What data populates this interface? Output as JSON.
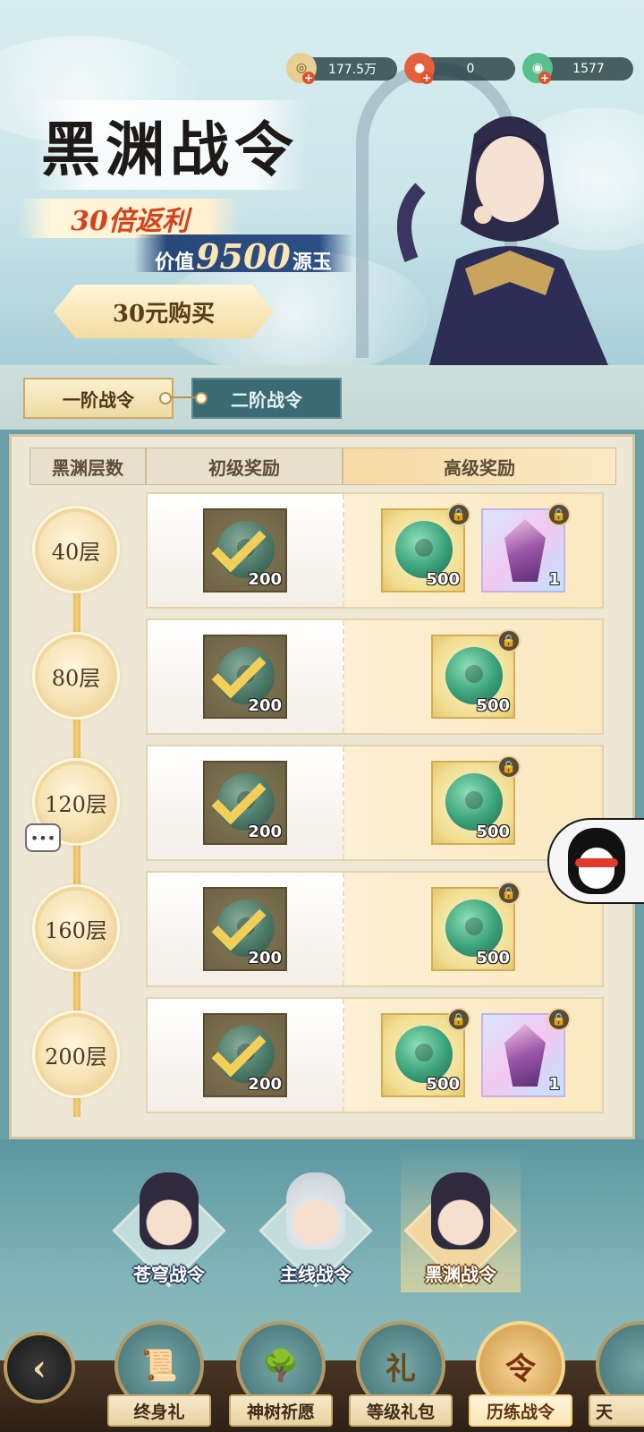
{
  "currencies": [
    {
      "icon": "coin-icon",
      "value": "177.5万",
      "color": "#d9b26a"
    },
    {
      "icon": "red-orb-icon",
      "value": "0",
      "color": "#e04f34"
    },
    {
      "icon": "jade-icon",
      "value": "1577",
      "color": "#45b07f"
    }
  ],
  "banner": {
    "title": "黑渊战令",
    "rebate": "30倍返利",
    "value_prefix": "价值",
    "value_number": "9500",
    "value_suffix": "源玉",
    "buy_button": "30元购买"
  },
  "tabs": [
    {
      "label": "一阶战令",
      "active": true
    },
    {
      "label": "二阶战令",
      "active": false
    }
  ],
  "columns": {
    "level": "黑渊层数",
    "basic": "初级奖励",
    "advanced": "高级奖励"
  },
  "rows": [
    {
      "level": "40层",
      "basic": {
        "item": "jade",
        "qty": "200",
        "claimed": true
      },
      "advanced": [
        {
          "item": "jade",
          "qty": "500",
          "locked": true
        },
        {
          "item": "crystal",
          "qty": "1",
          "locked": true
        }
      ]
    },
    {
      "level": "80层",
      "basic": {
        "item": "jade",
        "qty": "200",
        "claimed": true
      },
      "advanced": [
        {
          "item": "jade",
          "qty": "500",
          "locked": true
        }
      ]
    },
    {
      "level": "120层",
      "basic": {
        "item": "jade",
        "qty": "200",
        "claimed": true
      },
      "advanced": [
        {
          "item": "jade",
          "qty": "500",
          "locked": true
        }
      ]
    },
    {
      "level": "160层",
      "basic": {
        "item": "jade",
        "qty": "200",
        "claimed": true
      },
      "advanced": [
        {
          "item": "jade",
          "qty": "500",
          "locked": true
        }
      ]
    },
    {
      "level": "200层",
      "basic": {
        "item": "jade",
        "qty": "200",
        "claimed": true
      },
      "advanced": [
        {
          "item": "jade",
          "qty": "500",
          "locked": true
        },
        {
          "item": "crystal",
          "qty": "1",
          "locked": true
        }
      ]
    }
  ],
  "chat_bubble": "•••",
  "passes": [
    {
      "label": "苍穹战令",
      "active": false
    },
    {
      "label": "主线战令",
      "active": false
    },
    {
      "label": "黑渊战令",
      "active": true
    }
  ],
  "nav": [
    {
      "label": "终身礼",
      "icon": "scroll-gift-icon",
      "active": false
    },
    {
      "label": "神树祈愿",
      "icon": "golden-tree-icon",
      "active": false
    },
    {
      "label": "等级礼包",
      "icon": "gift-bag-icon",
      "active": false
    },
    {
      "label": "历练战令",
      "icon": "token-card-icon",
      "active": true
    },
    {
      "label": "天",
      "icon": "partial-nav-icon",
      "active": false
    }
  ],
  "nav_glyphs": {
    "scroll": "📜",
    "tree": "🌳",
    "bag": "礼",
    "token": "令"
  }
}
